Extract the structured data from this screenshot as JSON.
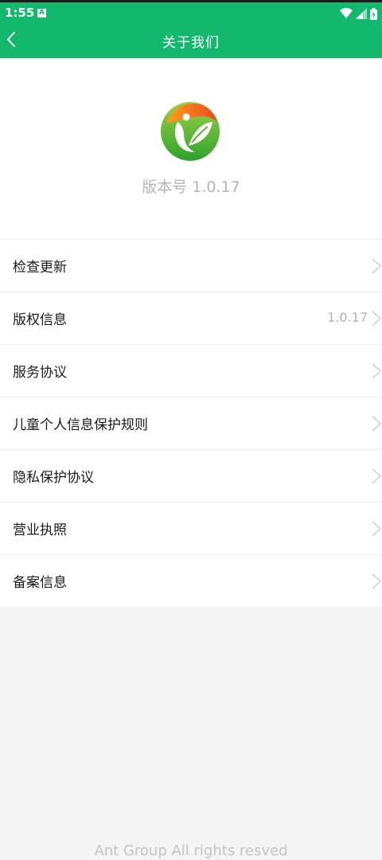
{
  "status_bar": {
    "time": "1:55",
    "notification_badge": "A",
    "icons": [
      "wifi-icon",
      "signal-icon",
      "battery-icon"
    ]
  },
  "header": {
    "title": "关于我们",
    "back_icon": "chevron-left-icon"
  },
  "app_info": {
    "logo_icon": "app-logo-leaf",
    "version_label": "版本号 1.0.17"
  },
  "menu": {
    "items": [
      {
        "label": "检查更新",
        "value": ""
      },
      {
        "label": "版权信息",
        "value": "1.0.17"
      },
      {
        "label": "服务协议",
        "value": ""
      },
      {
        "label": "儿童个人信息保护规则",
        "value": ""
      },
      {
        "label": "隐私保护协议",
        "value": ""
      },
      {
        "label": "营业执照",
        "value": ""
      },
      {
        "label": "备案信息",
        "value": ""
      }
    ]
  },
  "footer": {
    "text": "Ant Group All rights resved"
  },
  "colors": {
    "primary": "#12b96c",
    "background": "#f4f4f4",
    "text": "#1a1a1a",
    "muted": "#b3b3b3"
  }
}
